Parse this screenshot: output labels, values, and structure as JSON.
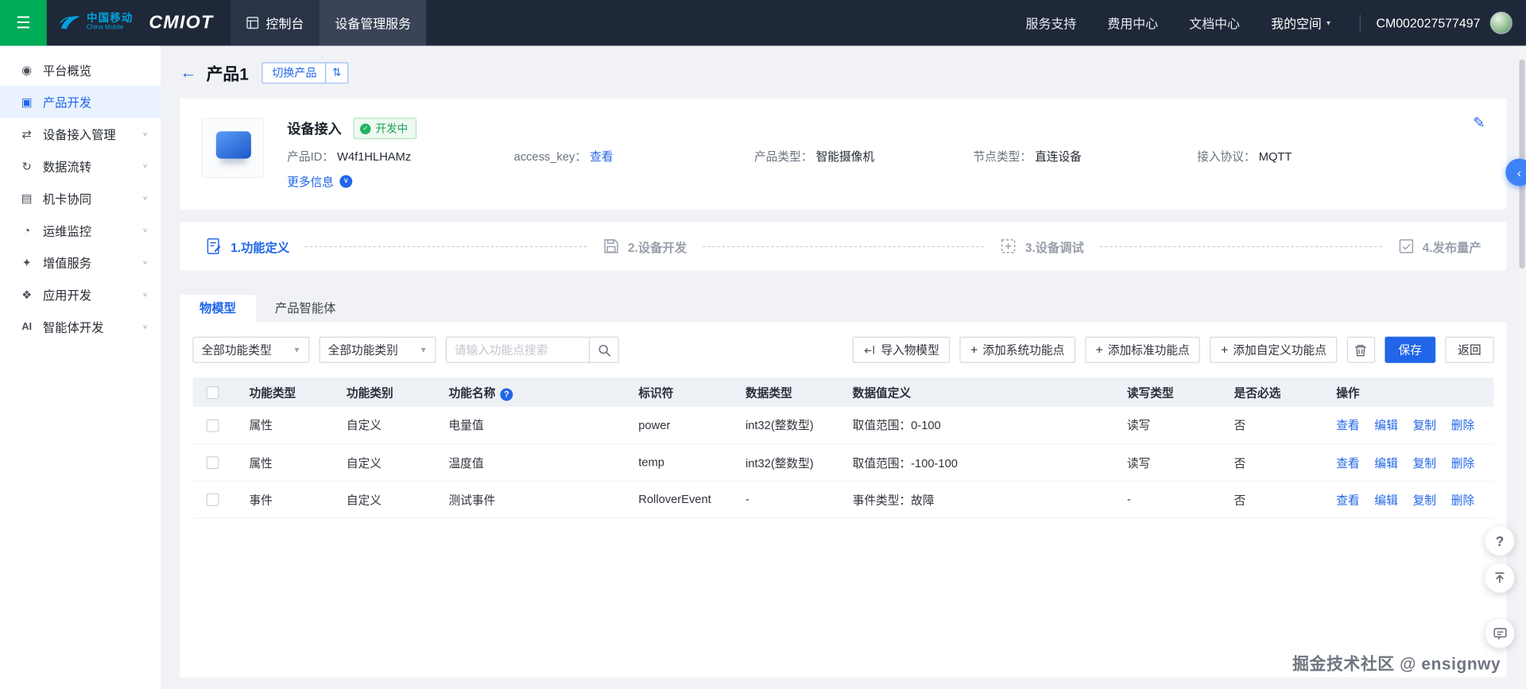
{
  "topbar": {
    "brand_cn": "中国移动",
    "brand_en": "China Mobile",
    "logo": "CMIOT",
    "tabs": [
      {
        "label": "控制台"
      },
      {
        "label": "设备管理服务"
      }
    ],
    "links": [
      "服务支持",
      "费用中心",
      "文档中心"
    ],
    "my_space": "我的空间",
    "account_id": "CM002027577497"
  },
  "sidebar": {
    "items": [
      {
        "label": "平台概览"
      },
      {
        "label": "产品开发"
      },
      {
        "label": "设备接入管理"
      },
      {
        "label": "数据流转"
      },
      {
        "label": "机卡协同"
      },
      {
        "label": "运维监控"
      },
      {
        "label": "增值服务"
      },
      {
        "label": "应用开发"
      },
      {
        "label": "智能体开发",
        "icon_text": "AI"
      }
    ]
  },
  "page": {
    "title": "产品1",
    "switch_product": "切换产品"
  },
  "product": {
    "name": "设备接入",
    "status": "开发中",
    "fields": [
      {
        "label": "产品ID：",
        "value": "W4f1HLHAMz"
      },
      {
        "label": "access_key：",
        "value": "查看"
      },
      {
        "label": "产品类型：",
        "value": "智能摄像机"
      },
      {
        "label": "节点类型：",
        "value": "直连设备"
      },
      {
        "label": "接入协议：",
        "value": "MQTT"
      }
    ],
    "more_info": "更多信息"
  },
  "steps": [
    {
      "label": "1.功能定义"
    },
    {
      "label": "2.设备开发"
    },
    {
      "label": "3.设备调试"
    },
    {
      "label": "4.发布量产"
    }
  ],
  "tabs": [
    {
      "label": "物模型"
    },
    {
      "label": "产品智能体"
    }
  ],
  "toolbar": {
    "filter_type": "全部功能类型",
    "filter_category": "全部功能类别",
    "search_placeholder": "请输入功能点搜索",
    "import": "导入物模型",
    "add_system": "添加系统功能点",
    "add_standard": "添加标准功能点",
    "add_custom": "添加自定义功能点",
    "save": "保存",
    "back": "返回"
  },
  "table": {
    "headers": [
      "功能类型",
      "功能类别",
      "功能名称",
      "标识符",
      "数据类型",
      "数据值定义",
      "读写类型",
      "是否必选",
      "操作"
    ],
    "rows": [
      {
        "type": "属性",
        "category": "自定义",
        "name": "电量值",
        "identifier": "power",
        "data_type": "int32(整数型)",
        "value_def": "取值范围：0-100",
        "rw": "读写",
        "required": "否"
      },
      {
        "type": "属性",
        "category": "自定义",
        "name": "温度值",
        "identifier": "temp",
        "data_type": "int32(整数型)",
        "value_def": "取值范围：-100-100",
        "rw": "读写",
        "required": "否"
      },
      {
        "type": "事件",
        "category": "自定义",
        "name": "测试事件",
        "identifier": "RolloverEvent",
        "data_type": "-",
        "value_def": "事件类型：故障",
        "rw": "-",
        "required": "否"
      }
    ],
    "actions": [
      "查看",
      "编辑",
      "复制",
      "删除"
    ]
  },
  "watermark": "掘金技术社区 @ ensignwy",
  "colors": {
    "accent": "#2166e8",
    "brand_green": "#00ab57",
    "status_green": "#18a058",
    "topbar_bg": "#1f2838"
  }
}
